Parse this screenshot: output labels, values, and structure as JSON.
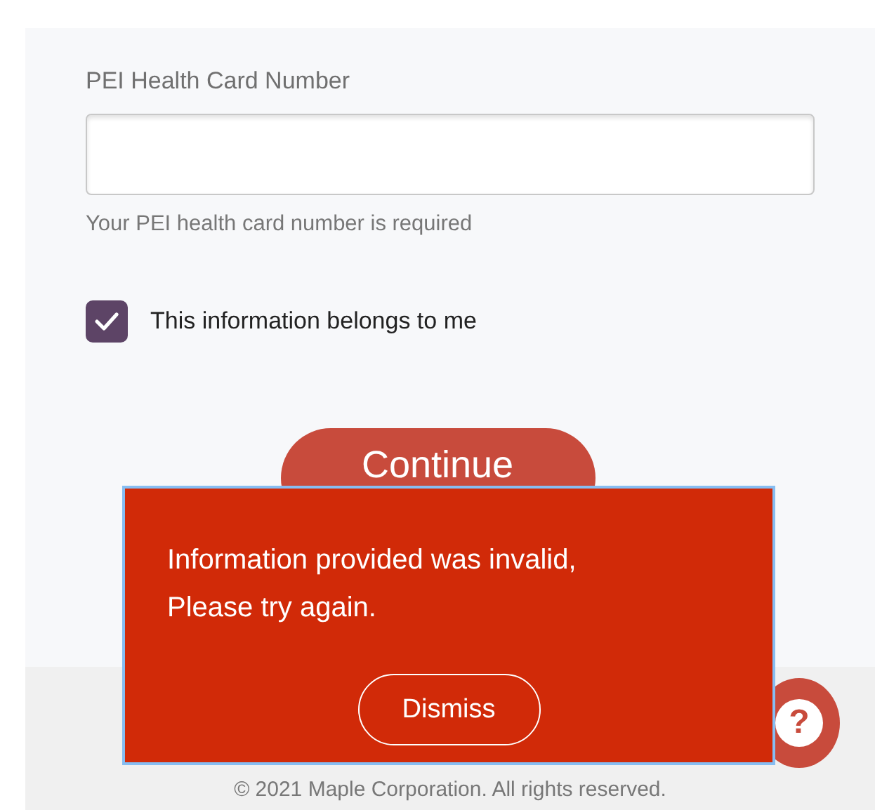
{
  "form": {
    "field": {
      "label": "PEI Health Card Number",
      "hint": "Your PEI health card number is required"
    },
    "checkbox": {
      "label": "This information belongs to me",
      "checked": true
    },
    "continue_button": "Continue"
  },
  "footer": {
    "copyright": "© 2021 Maple Corporation. All rights reserved."
  },
  "help_button": {
    "label": "?"
  },
  "toast": {
    "message": "Information provided was invalid,\nPlease try again.",
    "dismiss_button": "Dismiss"
  }
}
